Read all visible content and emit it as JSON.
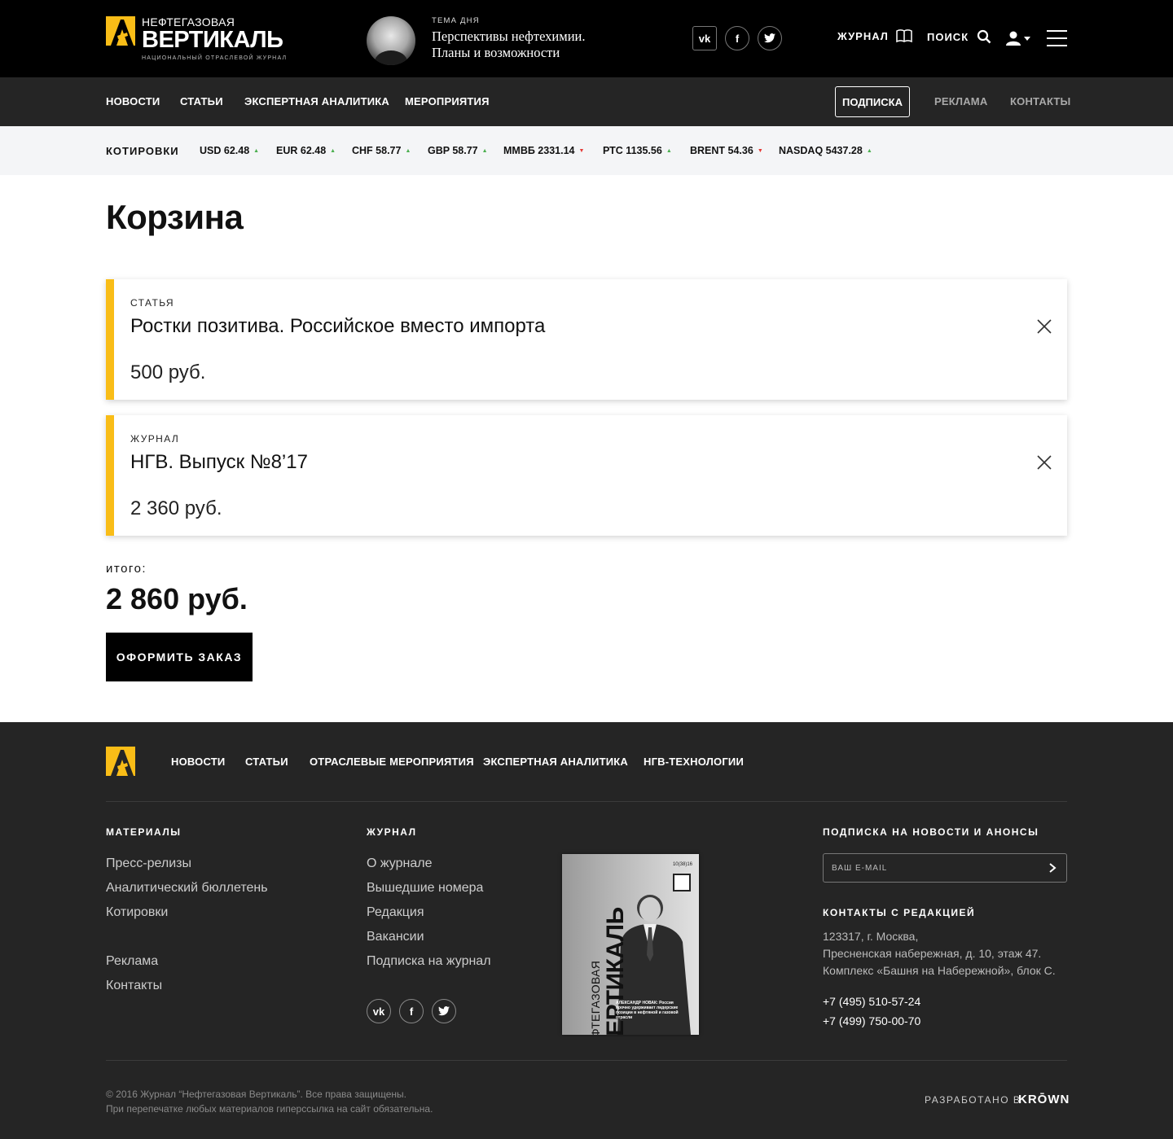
{
  "header": {
    "logo_top": "НЕФТЕГАЗОВАЯ",
    "logo_main": "ВЕРТИКАЛЬ",
    "logo_sub": "НАЦИОНАЛЬНЫЙ ОТРАСЛЕВОЙ ЖУРНАЛ",
    "topic_caption": "ТЕМА ДНЯ",
    "topic_title": "Перспективы нефтехимии. Планы и возможности",
    "social": [
      "vk-icon",
      "facebook-icon",
      "twitter-icon"
    ],
    "journal_label": "ЖУРНАЛ",
    "search_label": "ПОИСК"
  },
  "nav": {
    "items": [
      "НОВОСТИ",
      "СТАТЬИ",
      "ЭКСПЕРТНАЯ АНАЛИТИКА",
      "МЕРОПРИЯТИЯ"
    ],
    "subscribe": "ПОДПИСКА",
    "ads": "РЕКЛАМА",
    "contacts": "КОНТАКТЫ"
  },
  "quotes": {
    "label": "КОТИРОВКИ",
    "items": [
      {
        "name": "USD 62.48",
        "dir": "up"
      },
      {
        "name": "EUR 62.48",
        "dir": "up"
      },
      {
        "name": "CHF 58.77",
        "dir": "up"
      },
      {
        "name": "GBP 58.77",
        "dir": "up"
      },
      {
        "name": "ММВБ 2331.14",
        "dir": "down"
      },
      {
        "name": "РТС 1135.56",
        "dir": "up"
      },
      {
        "name": "BRENT 54.36",
        "dir": "down"
      },
      {
        "name": "NASDAQ 5437.28",
        "dir": "up"
      }
    ],
    "up_color": "#4caf50",
    "down_color": "#e53935"
  },
  "cart": {
    "title": "Корзина",
    "items": [
      {
        "category": "СТАТЬЯ",
        "title": "Ростки позитива. Российское вместо импорта",
        "price": "500 руб."
      },
      {
        "category": "ЖУРНАЛ",
        "title": "НГВ. Выпуск №8’17",
        "price": "2 360 руб."
      }
    ],
    "total_label": "итого:",
    "total": "2 860 руб.",
    "order_button": "ОФОРМИТЬ ЗАКАЗ",
    "accent_color": "#f9bd17"
  },
  "footer": {
    "nav": [
      "НОВОСТИ",
      "СТАТЬИ",
      "ОТРАСЛЕВЫЕ МЕРОПРИЯТИЯ",
      "ЭКСПЕРТНАЯ АНАЛИТИКА",
      "НГВ-ТЕХНОЛОГИИ"
    ],
    "materials_heading": "МАТЕРИАЛЫ",
    "materials": [
      "Пресс-релизы",
      "Аналитический бюллетень",
      "Котировки",
      "Реклама",
      "Контакты"
    ],
    "journal_heading": "ЖУРНАЛ",
    "journal": [
      "О журнале",
      "Вышедшие номера",
      "Редакция",
      "Вакансии",
      "Подписка на журнал"
    ],
    "cover": {
      "issue": "10(38)16",
      "title_top": "НЕФТЕГАЗОВАЯ",
      "title_main": "ВЕРТИКАЛЬ",
      "caption": "АЛЕКСАНДР НОВАК: Россия прочно удерживает лидерские позиции в нефтяной и газовой отрасли"
    },
    "subscribe_heading": "ПОДПИСКА НА НОВОСТИ И АНОНСЫ",
    "email_placeholder": "ВАШ E-MAIL",
    "contacts_heading": "КОНТАКТЫ С РЕДАКЦИЕЙ",
    "address": [
      "123317, г. Москва,",
      "Пресненская набережная, д. 10, этаж 47.",
      "Комплекс «Башня на Набережной», блок С."
    ],
    "phones": [
      "+7 (495) 510-57-24",
      "+7 (499) 750-00-70"
    ],
    "copyright": [
      "© 2016 Журнал “Нефтегазовая Вертикаль”. Все права защищены.",
      "При перепечатке любых материалов гиперссылка на сайт обязательна."
    ],
    "developed_by": "РАЗРАБОТАНО В",
    "developer": "KRŌWN"
  }
}
